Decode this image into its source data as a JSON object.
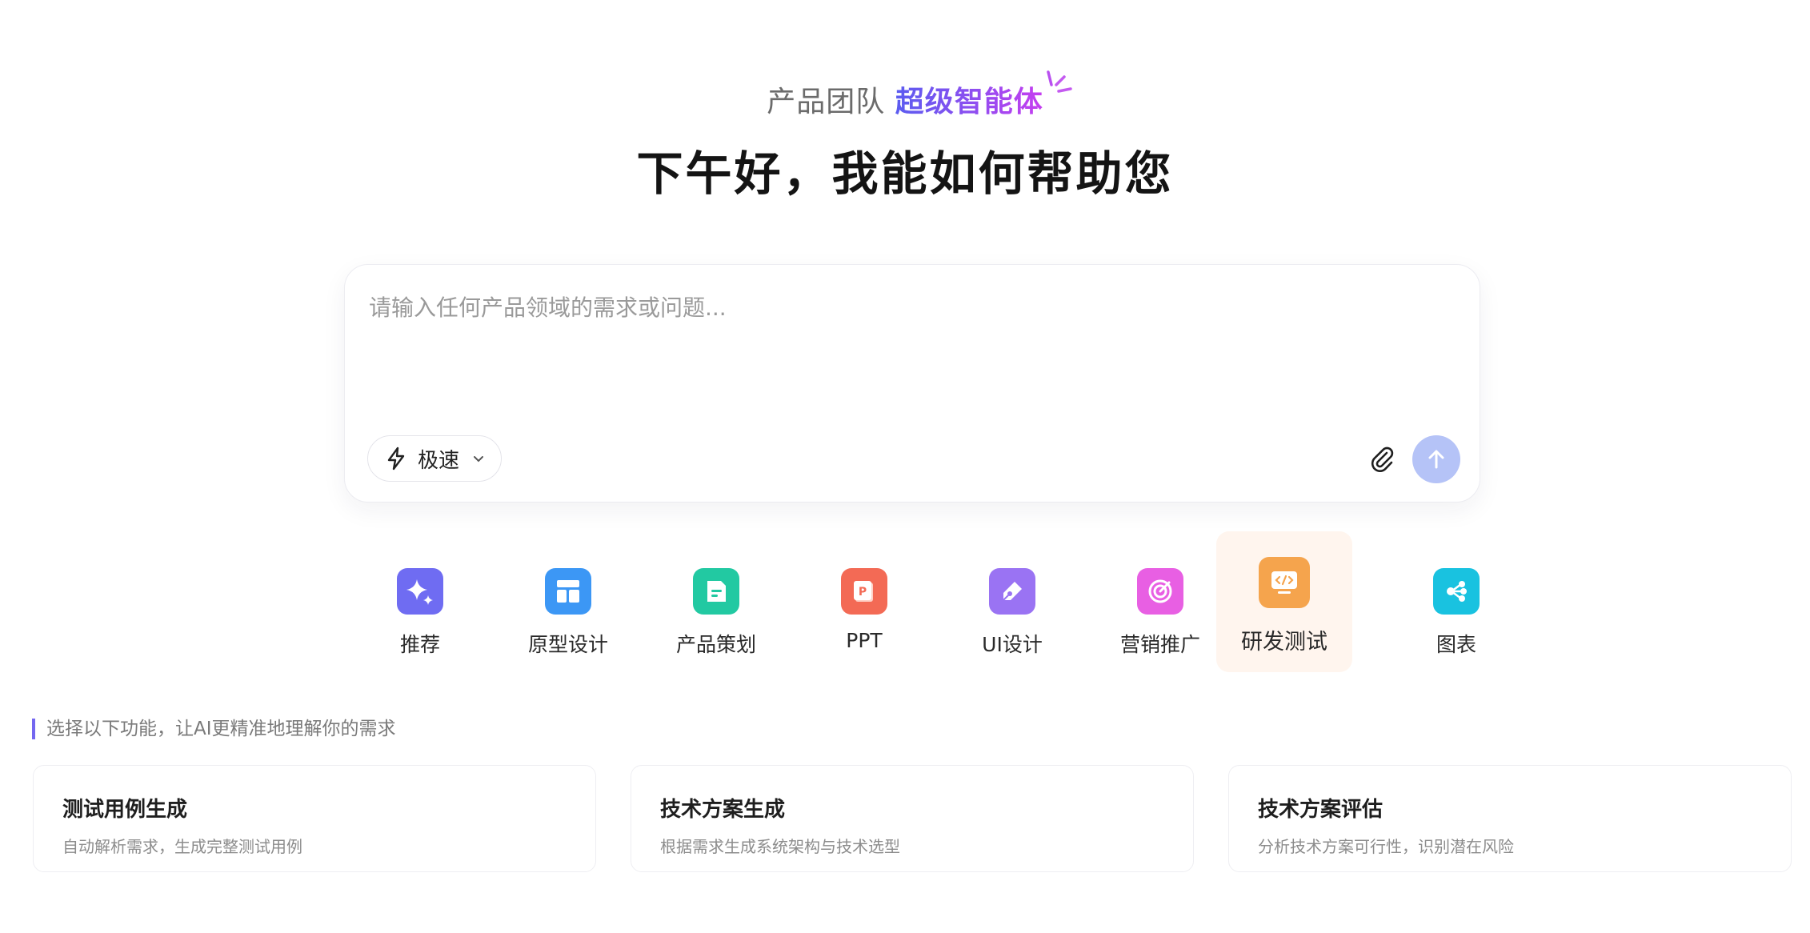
{
  "header": {
    "team_label": "产品团队",
    "agent_label": "超级智能体",
    "greeting": "下午好，我能如何帮助您"
  },
  "input": {
    "placeholder": "请输入任何产品领域的需求或问题...",
    "value": "",
    "mode_label": "极速",
    "send_color": "#b5c3f7"
  },
  "categories": [
    {
      "label": "推荐",
      "icon": "sparkle-icon",
      "color": "#6f6cf2"
    },
    {
      "label": "原型设计",
      "icon": "layout-icon",
      "color": "#3c97f5"
    },
    {
      "label": "产品策划",
      "icon": "document-icon",
      "color": "#22c9a2"
    },
    {
      "label": "PPT",
      "icon": "ppt-icon",
      "color": "#f36a55"
    },
    {
      "label": "UI设计",
      "icon": "pen-icon",
      "color": "#9a73f3"
    },
    {
      "label": "营销推广",
      "icon": "target-icon",
      "color": "#e85fe3"
    },
    {
      "label": "研发测试",
      "icon": "code-monitor-icon",
      "color": "#f5a44d"
    },
    {
      "label": "图表",
      "icon": "share-graph-icon",
      "color": "#19c2e0"
    }
  ],
  "active_category": "研发测试",
  "section_label": "选择以下功能，让AI更精准地理解你的需求",
  "features": [
    {
      "title": "测试用例生成",
      "desc": "自动解析需求，生成完整测试用例"
    },
    {
      "title": "技术方案生成",
      "desc": "根据需求生成系统架构与技术选型"
    },
    {
      "title": "技术方案评估",
      "desc": "分析技术方案可行性，识别潜在风险"
    }
  ]
}
